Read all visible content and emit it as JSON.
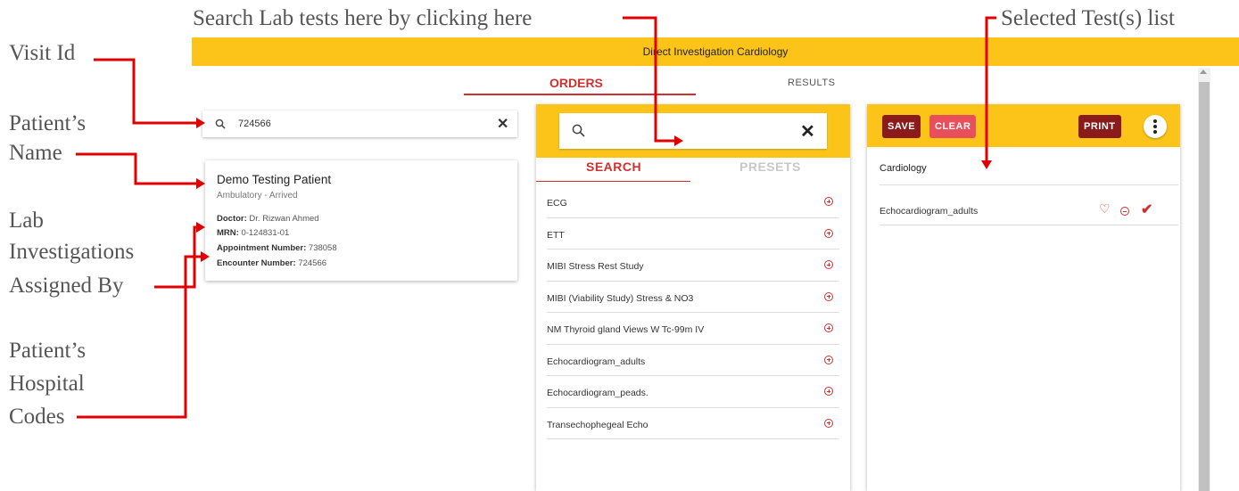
{
  "annotations": {
    "search_hint": "Search Lab tests here by clicking here",
    "selected_list": "Selected Test(s) list",
    "visit_id": "Visit Id",
    "patient_name_1": "Patient’s",
    "patient_name_2": "Name",
    "lab_1": "Lab",
    "lab_2": "Investigations",
    "lab_3": "Assigned By",
    "codes_1": "Patient’s",
    "codes_2": "Hospital",
    "codes_3": "Codes"
  },
  "header": {
    "title": "Direct Investigation Cardiology"
  },
  "tabs": {
    "orders": "ORDERS",
    "results": "RESULTS"
  },
  "visit_search": {
    "value": "724566"
  },
  "patient": {
    "name": "Demo Testing Patient",
    "status": "Ambulatory - Arrived",
    "doctor_label": "Doctor:",
    "doctor": "Dr. Rizwan Ahmed",
    "mrn_label": "MRN:",
    "mrn": "0-124831-01",
    "appointment_label": "Appointment Number:",
    "appointment": "738058",
    "encounter_label": "Encounter Number:",
    "encounter": "724566"
  },
  "search_panel": {
    "search_tab": "SEARCH",
    "presets_tab": "PRESETS",
    "tests": [
      "ECG",
      "ETT",
      "MIBI Stress Rest Study",
      "MIBI (Viability Study) Stress & NO3",
      "NM Thyroid gland Views W Tc-99m IV",
      "Echocardiogram_adults",
      "Echocardiogram_peads.",
      "Transechophegeal Echo"
    ]
  },
  "selected_panel": {
    "save": "SAVE",
    "clear": "CLEAR",
    "print": "PRINT",
    "category": "Cardiology",
    "items": [
      "Echocardiogram_adults"
    ]
  },
  "colors": {
    "header": "#fcc419",
    "accent": "#d32f2f",
    "dark_button": "#8b1a1a",
    "clear_button": "#e94f5b"
  }
}
